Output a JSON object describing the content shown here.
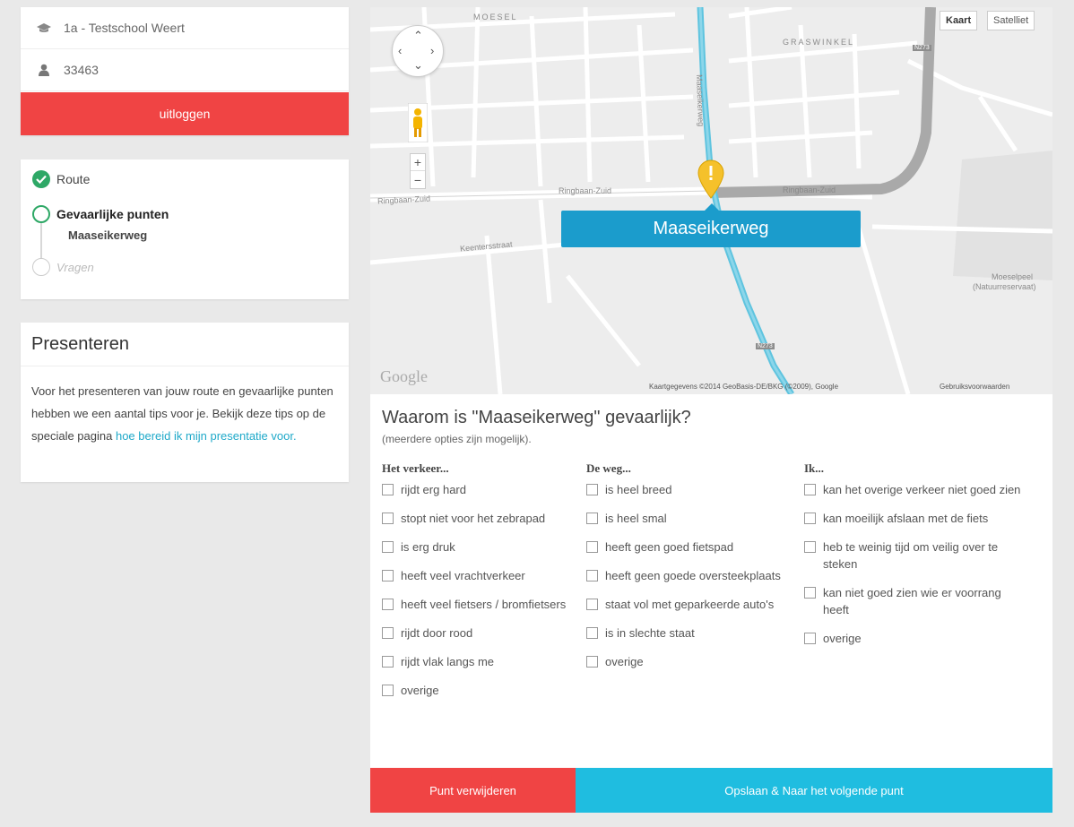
{
  "user": {
    "school": "1a - Testschool Weert",
    "student_id": "33463",
    "logout_label": "uitloggen"
  },
  "steps": {
    "route": "Route",
    "danger_points": "Gevaarlijke punten",
    "danger_point_current": "Maaseikerweg",
    "questions": "Vragen"
  },
  "present": {
    "title": "Presenteren",
    "text_before_link": "Voor het presenteren van jouw route en gevaarlijke punten hebben we een aantal tips voor je. Bekijk deze tips op de speciale pagina ",
    "link_text": "hoe bereid ik mijn presentatie voor."
  },
  "map": {
    "map_type_map": "Kaart",
    "map_type_satellite": "Satelliet",
    "street_label": "Maaseikerweg",
    "google_logo": "Google",
    "attribution": "Kaartgegevens ©2014 GeoBasis-DE/BKG (©2009), Google",
    "terms": "Gebruiksvoorwaarden",
    "labels": {
      "moesel": "MOESEL",
      "graswinkel": "GRASWINKEL",
      "ringbaan_zuid_1": "Ringbaan-Zuid",
      "ringbaan_zuid_2": "Ringbaan-Zuid",
      "ringbaan_zuid_3": "Ringbaan-Zuid",
      "maaseikerweg_road": "Maaseikerweg",
      "keentersstraat": "Keentersstraat",
      "moeselpeel": "Moeselpeel",
      "natuurreservaat": "(Natuurreservaat)",
      "n273_top": "N273",
      "n273_bottom": "N273"
    }
  },
  "question": {
    "title": "Waarom is \"Maaseikerweg\" gevaarlijk?",
    "hint": "(meerdere opties zijn mogelijk).",
    "columns": [
      {
        "heading": "Het verkeer...",
        "options": [
          "rijdt erg hard",
          "stopt niet voor het zebrapad",
          "is erg druk",
          "heeft veel vrachtverkeer",
          "heeft veel fietsers / bromfietsers",
          "rijdt door rood",
          "rijdt vlak langs me",
          "overige"
        ]
      },
      {
        "heading": "De weg...",
        "options": [
          "is heel breed",
          "is heel smal",
          "heeft geen goed fietspad",
          "heeft geen goede oversteekplaats",
          "staat vol met geparkeerde auto's",
          "is in slechte staat",
          "overige"
        ]
      },
      {
        "heading": "Ik...",
        "options": [
          "kan het overige verkeer niet goed zien",
          "kan moeilijk afslaan met de fiets",
          "heb te weinig tijd om veilig over te steken",
          "kan niet goed zien wie er voorrang heeft",
          "overige"
        ]
      }
    ]
  },
  "actions": {
    "delete_label": "Punt verwijderen",
    "save_label": "Opslaan & Naar het volgende punt"
  },
  "colors": {
    "accent_red": "#f04444",
    "accent_cyan": "#1fbde0",
    "street_blue": "#1b9ccc",
    "success_green": "#2ea866"
  }
}
